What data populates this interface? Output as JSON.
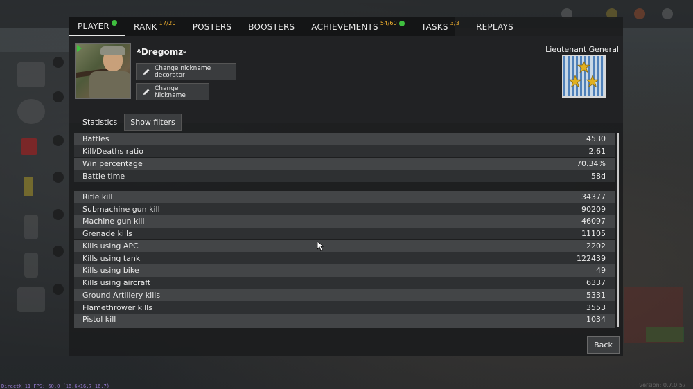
{
  "tabs": [
    {
      "label": "PLAYER",
      "active": true,
      "badge": "",
      "dot": true
    },
    {
      "label": "RANK",
      "active": false,
      "badge": "17/20",
      "dot": false
    },
    {
      "label": "POSTERS",
      "active": false,
      "badge": "",
      "dot": false
    },
    {
      "label": "BOOSTERS",
      "active": false,
      "badge": "",
      "dot": false
    },
    {
      "label": "ACHIEVEMENTS",
      "active": false,
      "badge": "54/60",
      "dot": true
    },
    {
      "label": "TASKS",
      "active": false,
      "badge": "3/3",
      "dot": false
    },
    {
      "label": "REPLAYS",
      "active": false,
      "badge": "",
      "dot": false
    }
  ],
  "player": {
    "nickname": "⸛Dregomz⸚",
    "change_decorator_label": "Change nickname decorator",
    "change_nickname_label": "Change Nickname",
    "rank_title": "Lieutenant General",
    "rank_stars": 3
  },
  "statistics": {
    "label": "Statistics",
    "filters_label": "Show filters",
    "groups": [
      [
        {
          "name": "Battles",
          "value": "4530"
        },
        {
          "name": "Kill/Deaths ratio",
          "value": "2.61"
        },
        {
          "name": "Win percentage",
          "value": "70.34%"
        },
        {
          "name": "Battle time",
          "value": "58d"
        }
      ],
      [
        {
          "name": "Rifle kill",
          "value": "34377"
        },
        {
          "name": "Submachine gun kill",
          "value": "90209"
        },
        {
          "name": "Machine gun kill",
          "value": "46097"
        },
        {
          "name": "Grenade kills",
          "value": "11105"
        },
        {
          "name": "Kills using APC",
          "value": "2202"
        },
        {
          "name": "Kills using tank",
          "value": "122439"
        },
        {
          "name": "Kills using bike",
          "value": "49"
        },
        {
          "name": "Kills using aircraft",
          "value": "6337"
        },
        {
          "name": "Ground Artillery kills",
          "value": "5331"
        },
        {
          "name": "Flamethrower kills",
          "value": "3553"
        },
        {
          "name": "Pistol kill",
          "value": "1034"
        }
      ]
    ]
  },
  "back_label": "Back",
  "fps_text": "DirectX 11 FPS: 60.0 (16.6<16.7 16.7)",
  "version_text": "version: 0.7.0.57",
  "colors": {
    "badge": "#f0b030",
    "online_dot": "#3fbf3f",
    "row_light": "#434547",
    "row_dark": "#2e3032"
  }
}
